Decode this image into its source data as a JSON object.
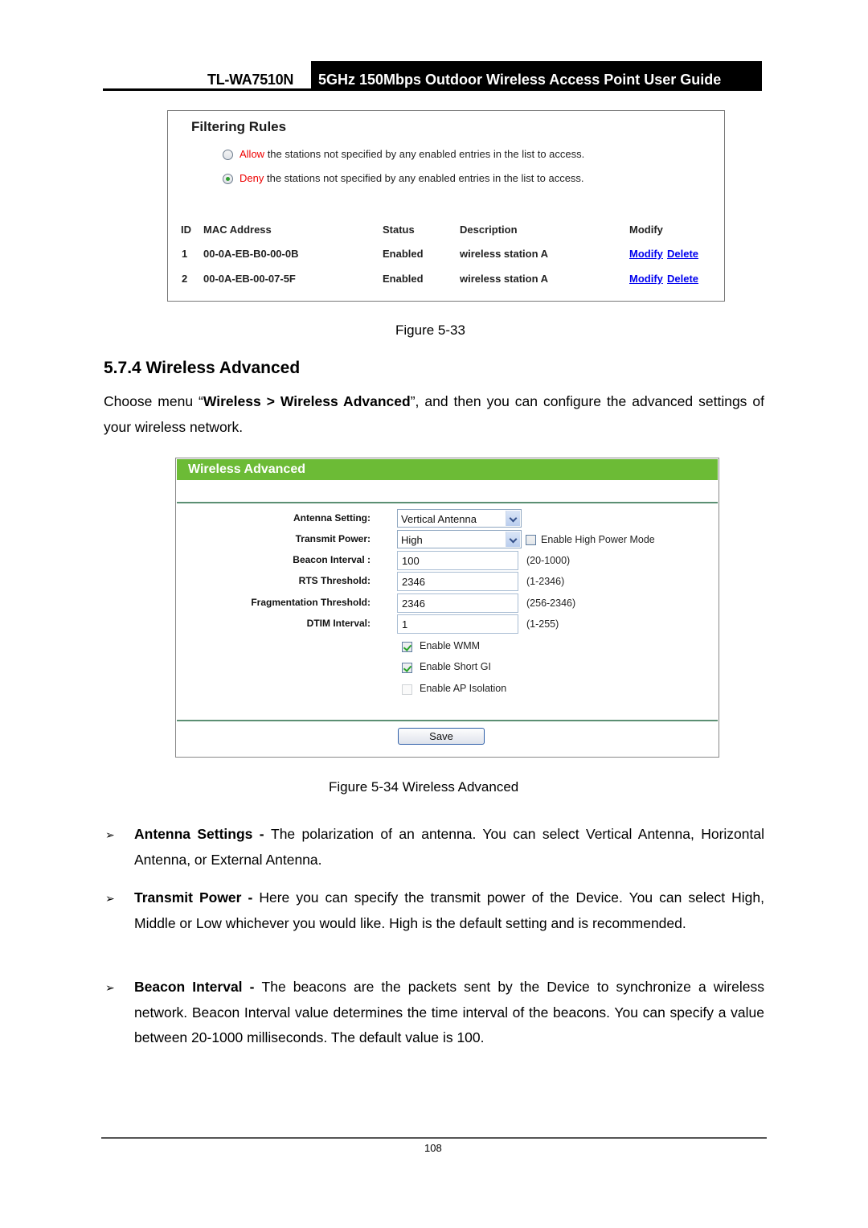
{
  "header": {
    "model": "TL-WA7510N",
    "title": "5GHz 150Mbps Outdoor Wireless Access Point User Guide"
  },
  "figure33": {
    "title": "Filtering Rules",
    "rules": [
      {
        "keyword": "Allow",
        "text": " the stations not specified by any enabled entries in the list to access.",
        "selected": false
      },
      {
        "keyword": "Deny",
        "text": " the stations not specified by any enabled entries in the list to access.",
        "selected": true
      }
    ],
    "table": {
      "headers": [
        "ID",
        "MAC Address",
        "Status",
        "Description",
        "Modify"
      ],
      "rows": [
        {
          "id": "1",
          "mac": "00-0A-EB-B0-00-0B",
          "status": "Enabled",
          "description": "wireless station A",
          "modify": "Modify",
          "delete": "Delete"
        },
        {
          "id": "2",
          "mac": "00-0A-EB-00-07-5F",
          "status": "Enabled",
          "description": "wireless station A",
          "modify": "Modify",
          "delete": "Delete"
        }
      ]
    },
    "caption": "Figure 5-33"
  },
  "section": {
    "title": "5.7.4  Wireless Advanced",
    "intro_pre": "Choose menu “",
    "intro_bold": "Wireless > Wireless Advanced",
    "intro_post": "”, and then you can configure the advanced settings of your wireless network."
  },
  "figure34": {
    "panel_title": "Wireless Advanced",
    "fields": {
      "antenna": {
        "label": "Antenna Setting:",
        "value": "Vertical Antenna"
      },
      "power": {
        "label": "Transmit Power:",
        "value": "High",
        "extra_checkbox": "Enable High Power Mode",
        "extra_checked": false
      },
      "beacon": {
        "label": "Beacon Interval :",
        "value": "100",
        "hint": "(20-1000)"
      },
      "rts": {
        "label": "RTS Threshold:",
        "value": "2346",
        "hint": "(1-2346)"
      },
      "frag": {
        "label": "Fragmentation Threshold:",
        "value": "2346",
        "hint": "(256-2346)"
      },
      "dtim": {
        "label": "DTIM Interval:",
        "value": "1",
        "hint": "(1-255)"
      }
    },
    "checkboxes": [
      {
        "label": "Enable WMM",
        "checked": true
      },
      {
        "label": "Enable Short GI",
        "checked": true
      },
      {
        "label": "Enable AP Isolation",
        "checked": false
      }
    ],
    "save_label": "Save",
    "caption": "Figure 5-34 Wireless Advanced"
  },
  "bullets": [
    {
      "term": "Antenna Settings - ",
      "text": "The polarization of an antenna. You can select Vertical Antenna, Horizontal Antenna, or External Antenna."
    },
    {
      "term": "Transmit Power - ",
      "text": "Here you can specify the transmit power of the Device. You can select High, Middle or Low whichever you would like. High is the default setting and is recommended."
    },
    {
      "term": "Beacon Interval - ",
      "text": "The beacons are the packets sent by the Device to synchronize a wireless network. Beacon Interval value determines the time interval of the beacons. You can specify a value between 20-1000 milliseconds. The default value is 100."
    }
  ],
  "bullet_glyph": "➢",
  "footer": {
    "page": "108"
  }
}
